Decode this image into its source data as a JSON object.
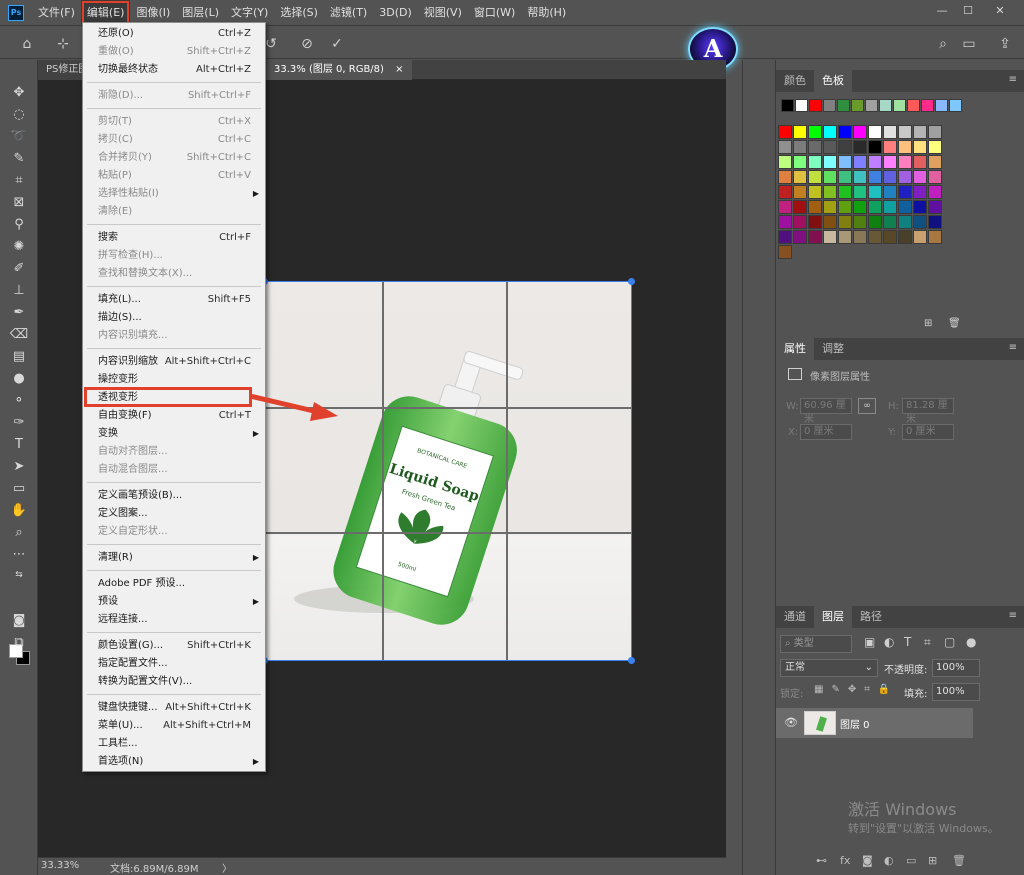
{
  "app": {
    "logo_text": "Ps"
  },
  "menubar": {
    "items": [
      "文件(F)",
      "编辑(E)",
      "图像(I)",
      "图层(L)",
      "文字(Y)",
      "选择(S)",
      "滤镜(T)",
      "3D(D)",
      "视图(V)",
      "窗口(W)",
      "帮助(H)"
    ],
    "active_index": 1
  },
  "window_controls": {
    "minimize": "—",
    "maximize": "☐",
    "close": "✕"
  },
  "brand_logo": {
    "letter": "A"
  },
  "tabs": {
    "doc1": "PS修正图",
    "doc2": "33.3% (图层 0, RGB/8)",
    "doc2_close": "×"
  },
  "edit_menu": {
    "items": [
      {
        "label": "还原(O)",
        "shortcut": "Ctrl+Z",
        "disabled": false
      },
      {
        "label": "重做(O)",
        "shortcut": "Shift+Ctrl+Z",
        "disabled": true
      },
      {
        "label": "切换最终状态",
        "shortcut": "Alt+Ctrl+Z",
        "disabled": false
      },
      {
        "label": "渐隐(D)...",
        "shortcut": "Shift+Ctrl+F",
        "disabled": true
      },
      {
        "label": "剪切(T)",
        "shortcut": "Ctrl+X",
        "disabled": true
      },
      {
        "label": "拷贝(C)",
        "shortcut": "Ctrl+C",
        "disabled": true
      },
      {
        "label": "合并拷贝(Y)",
        "shortcut": "Shift+Ctrl+C",
        "disabled": true
      },
      {
        "label": "粘贴(P)",
        "shortcut": "Ctrl+V",
        "disabled": true
      },
      {
        "label": "选择性粘贴(I)",
        "shortcut": "",
        "disabled": true,
        "submenu": true
      },
      {
        "label": "清除(E)",
        "shortcut": "",
        "disabled": true
      },
      {
        "label": "搜索",
        "shortcut": "Ctrl+F",
        "disabled": false
      },
      {
        "label": "拼写检查(H)...",
        "shortcut": "",
        "disabled": true
      },
      {
        "label": "查找和替换文本(X)...",
        "shortcut": "",
        "disabled": true
      },
      {
        "label": "填充(L)...",
        "shortcut": "Shift+F5",
        "disabled": false
      },
      {
        "label": "描边(S)...",
        "shortcut": "",
        "disabled": false
      },
      {
        "label": "内容识别填充...",
        "shortcut": "",
        "disabled": true
      },
      {
        "label": "内容识别缩放",
        "shortcut": "Alt+Shift+Ctrl+C",
        "disabled": false
      },
      {
        "label": "操控变形",
        "shortcut": "",
        "disabled": false
      },
      {
        "label": "透视变形",
        "shortcut": "",
        "disabled": false
      },
      {
        "label": "自由变换(F)",
        "shortcut": "Ctrl+T",
        "disabled": false
      },
      {
        "label": "变换",
        "shortcut": "",
        "disabled": false,
        "submenu": true
      },
      {
        "label": "自动对齐图层...",
        "shortcut": "",
        "disabled": true
      },
      {
        "label": "自动混合图层...",
        "shortcut": "",
        "disabled": true
      },
      {
        "label": "定义画笔预设(B)...",
        "shortcut": "",
        "disabled": false
      },
      {
        "label": "定义图案...",
        "shortcut": "",
        "disabled": false
      },
      {
        "label": "定义自定形状...",
        "shortcut": "",
        "disabled": true
      },
      {
        "label": "清理(R)",
        "shortcut": "",
        "disabled": false,
        "submenu": true
      },
      {
        "label": "Adobe PDF 预设...",
        "shortcut": "",
        "disabled": false
      },
      {
        "label": "预设",
        "shortcut": "",
        "disabled": false,
        "submenu": true
      },
      {
        "label": "远程连接...",
        "shortcut": "",
        "disabled": false
      },
      {
        "label": "颜色设置(G)...",
        "shortcut": "Shift+Ctrl+K",
        "disabled": false
      },
      {
        "label": "指定配置文件...",
        "shortcut": "",
        "disabled": false
      },
      {
        "label": "转换为配置文件(V)...",
        "shortcut": "",
        "disabled": false
      },
      {
        "label": "键盘快捷键...",
        "shortcut": "Alt+Shift+Ctrl+K",
        "disabled": false
      },
      {
        "label": "菜单(U)...",
        "shortcut": "Alt+Shift+Ctrl+M",
        "disabled": false
      },
      {
        "label": "工具栏...",
        "shortcut": "",
        "disabled": false
      },
      {
        "label": "首选项(N)",
        "shortcut": "",
        "disabled": false,
        "submenu": true
      }
    ],
    "highlighted_item": "透视变形"
  },
  "panels": {
    "color_tabs": [
      "颜色",
      "色板"
    ],
    "recent_swatches": [
      "#000000",
      "#ffffff",
      "#ff0000",
      "#808080",
      "#2f8f3f",
      "#6a9a2a",
      "#a0a0a0",
      "#a7d7c7",
      "#a0e0a0",
      "#ff5a5a",
      "#ff2a8a",
      "#8ab8ff",
      "#7fc8ff"
    ],
    "swatch_rows": [
      [
        "#ff0000",
        "#ffff00",
        "#00ff00",
        "#00ffff",
        "#0000ff",
        "#ff00ff",
        "#ffffff",
        "#e0e0e0",
        "#c8c8c8",
        "#b4b4b4",
        "#a0a0a0"
      ],
      [
        "#909090",
        "#7c7c7c",
        "#6a6a6a",
        "#595959",
        "#404040",
        "#2a2a2a",
        "#000000",
        "#ff7f7f",
        "#ffbf7f",
        "#ffdf7f",
        "#ffff7f"
      ],
      [
        "#bfff7f",
        "#7fff7f",
        "#7fffbf",
        "#7fffff",
        "#7fbfff",
        "#7f7fff",
        "#bf7fff",
        "#ff7fff",
        "#ff7fbf",
        "#e06060",
        "#e0a060"
      ],
      [
        "#e08040",
        "#e0c040",
        "#c0e040",
        "#60e060",
        "#40c080",
        "#40c0c0",
        "#4080e0",
        "#6060e0",
        "#a060e0",
        "#e060e0",
        "#e060a0"
      ],
      [
        "#c02020",
        "#c08020",
        "#c0c020",
        "#80c020",
        "#20c020",
        "#20c080",
        "#20c0c0",
        "#2080c0",
        "#2020c0",
        "#8020c0",
        "#c020c0"
      ],
      [
        "#c02080",
        "#a01010",
        "#a06010",
        "#a0a010",
        "#60a010",
        "#10a010",
        "#10a060",
        "#10a0a0",
        "#1060a0",
        "#1010a0",
        "#6010a0"
      ],
      [
        "#a010a0",
        "#a01060",
        "#801010",
        "#805010",
        "#808010",
        "#508010",
        "#108010",
        "#108050",
        "#108080",
        "#105080",
        "#101080"
      ],
      [
        "#501080",
        "#801080",
        "#801050",
        "#c8b8a0",
        "#a89878",
        "#887858",
        "#685838",
        "#584828",
        "#484028",
        "#c8a070",
        "#a87840"
      ],
      [
        "#885020"
      ]
    ],
    "properties_tabs": [
      "属性",
      "调整"
    ],
    "properties_title": "像素图层属性",
    "properties": {
      "w_label": "W:",
      "w_value": "60.96 厘米",
      "h_label": "H:",
      "h_value": "81.28 厘米",
      "x_label": "X:",
      "x_value": "0 厘米",
      "y_label": "Y:",
      "y_value": "0 厘米"
    },
    "layers_tabs": [
      "通道",
      "图层",
      "路径"
    ],
    "layers": {
      "filter_placeholder": "类型",
      "blend_mode": "正常",
      "opacity_label": "不透明度:",
      "opacity_value": "100%",
      "lock_label": "锁定:",
      "fill_label": "填充:",
      "fill_value": "100%",
      "layer_name": "图层 0"
    }
  },
  "watermark": {
    "line1": "激活 Windows",
    "line2": "转到\"设置\"以激活 Windows。"
  },
  "statusbar": {
    "zoom": "33.33%",
    "doc_info": "文档:6.89M/6.89M",
    "arrow": "〉"
  },
  "product": {
    "brand_small": "BOTANICAL CARE",
    "name_line1": "Liquid Soap",
    "name_line2": "Fresh Green Tea",
    "volume": "500ml"
  }
}
